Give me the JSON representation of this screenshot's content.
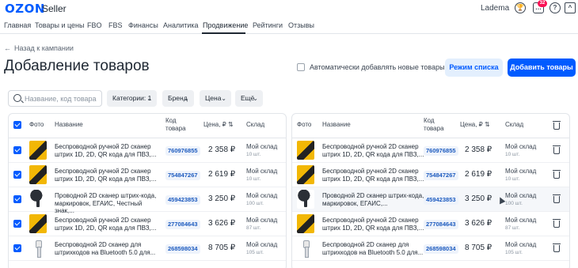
{
  "topbar": {
    "logo": "OZON",
    "logo_sub": "Seller",
    "account": "Ladema",
    "notifications_count": "32",
    "icons": [
      "trophy-icon",
      "chat-icon",
      "help-icon",
      "graduation-icon"
    ]
  },
  "nav": {
    "items": [
      "Главная",
      "Товары и цены",
      "FBO",
      "FBS",
      "Финансы",
      "Аналитика",
      "Продвижение",
      "Рейтинги",
      "Отзывы"
    ],
    "active": "Продвижение"
  },
  "back_link": "Назад к кампании",
  "page_title": "Добавление товаров",
  "auto_add_label": "Автоматически добавлять новые товары",
  "buttons": {
    "list_mode": "Режим списка",
    "add_products": "Добавить товары"
  },
  "filters": {
    "search_placeholder": "Название, код товара",
    "category": "Категории: 1",
    "brand": "Бренд",
    "price": "Цена",
    "more": "Ещё"
  },
  "table": {
    "columns": {
      "photo": "Фото",
      "name": "Название",
      "code_line1": "Код",
      "code_line2": "товара",
      "price": "Цена, ₽",
      "warehouse": "Склад"
    },
    "rows": [
      {
        "name_left": "Беспроводной ручной 2D сканер штрих 1D, 2D, QR кода для ПВЗ,...",
        "name_right": "Беспроводной ручной 2D сканер штрих 1D, 2D, QR кода для ПВЗ,...",
        "code": "760976855",
        "price": "2 358 ₽",
        "warehouse": "Мой склад",
        "qty": "10 шт.",
        "thumb": "yellow-scanner"
      },
      {
        "name_left": "Беспроводной ручной 2D сканер штрих 1D, 2D, QR кода для ПВЗ,...",
        "name_right": "Беспроводной ручной 2D сканер штрих 1D, 2D, QR кода для ПВЗ,...",
        "code": "754847267",
        "price": "2 619 ₽",
        "warehouse": "Мой склад",
        "qty": "10 шт.",
        "thumb": "yellow-scanner"
      },
      {
        "name_left": "Проводной 2D сканер штрих-кода, маркировок, ЕГАИС, Честный знак,...",
        "name_right": "Проводной 2D сканер штрих-кода, маркировок, ЕГАИС,...",
        "code": "459423853",
        "price": "3 250 ₽",
        "warehouse": "Мой склад",
        "qty": "100 шт.",
        "thumb": "black-scanner"
      },
      {
        "name_left": "Беспроводной ручной 2D сканер штрих 1D, 2D, QR кода для ПВЗ,...",
        "name_right": "Беспроводной ручной 2D сканер штрих 1D, 2D, QR кода для ПВЗ,...",
        "code": "277084643",
        "price": "3 626 ₽",
        "warehouse": "Мой склад",
        "qty": "87 шт.",
        "thumb": "yellow-scanner"
      },
      {
        "name_left": "Беспроводной 2D сканер для штрихкодов на Bluetooth 5.0 для...",
        "name_right": "Беспроводной 2D сканер для штрихкодов на Bluetooth 5.0 для...",
        "code": "268598034",
        "price": "8 705 ₽",
        "warehouse": "Мой склад",
        "qty": "105 шт.",
        "thumb": "white-scanner"
      }
    ]
  },
  "colors": {
    "accent": "#005bff",
    "badge": "#f91155",
    "code_bg": "#eef3fb"
  }
}
